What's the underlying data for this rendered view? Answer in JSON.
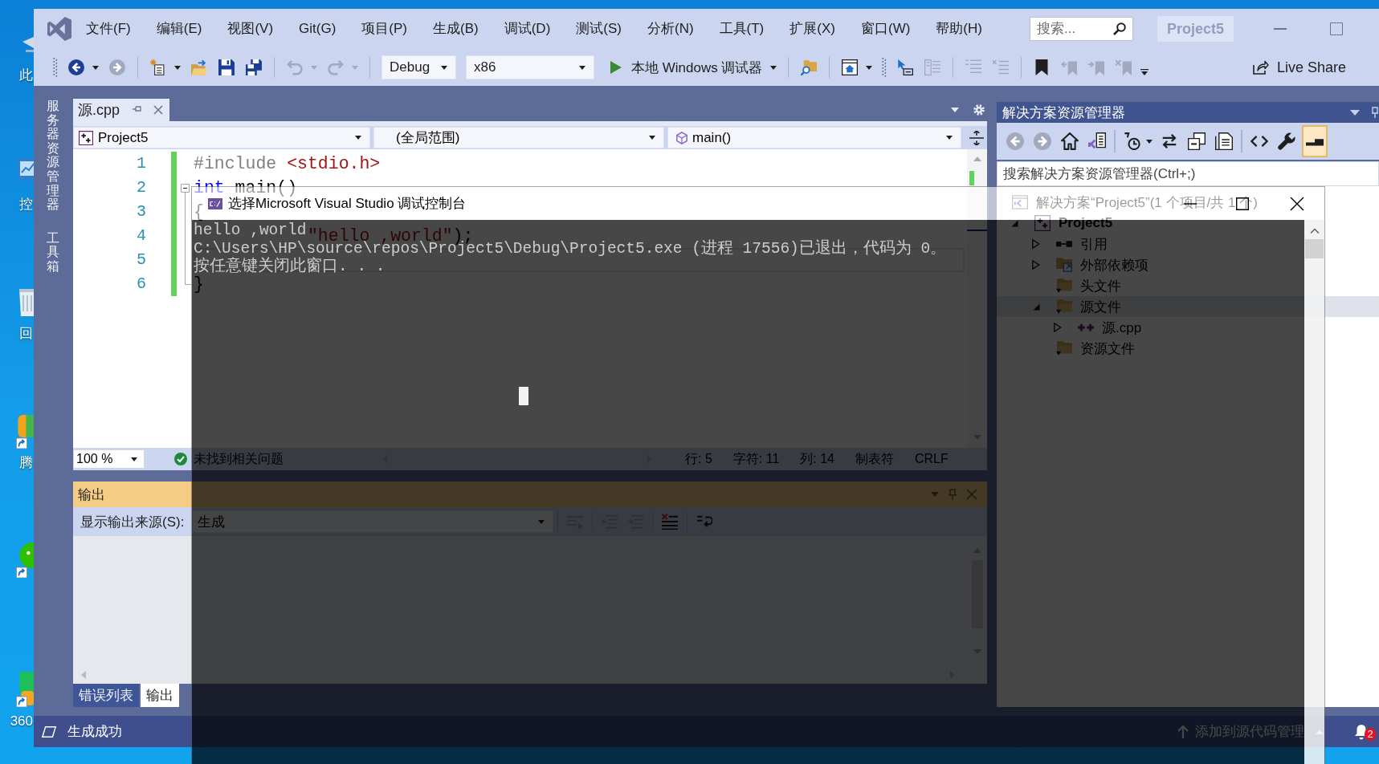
{
  "desktop": {
    "icons": [
      {
        "kind": "computer",
        "label": "此",
        "shortcut": false
      },
      {
        "kind": "control-panel",
        "label": "控",
        "shortcut": false
      },
      {
        "kind": "recycle-bin",
        "label": "回",
        "shortcut": false
      },
      {
        "kind": "app",
        "label": "腾",
        "shortcut": true
      },
      {
        "kind": "chat",
        "shortcut": true
      },
      {
        "kind": "shield",
        "label": "360",
        "shortcut": true
      }
    ]
  },
  "ide": {
    "menu": [
      "文件(F)",
      "编辑(E)",
      "视图(V)",
      "Git(G)",
      "项目(P)",
      "生成(B)",
      "调试(D)",
      "测试(S)",
      "分析(N)",
      "工具(T)",
      "扩展(X)",
      "窗口(W)",
      "帮助(H)"
    ],
    "search": {
      "placeholder": "搜索..."
    },
    "title": "Project5",
    "toolbar": {
      "items": [
        {
          "kind": "grip"
        },
        {
          "kind": "back",
          "disabled": false,
          "dropdown": true
        },
        {
          "kind": "forward",
          "disabled": true,
          "dropdown": false
        },
        {
          "kind": "separator"
        },
        {
          "kind": "new-project",
          "disabled": false,
          "dropdown": true
        },
        {
          "kind": "open",
          "disabled": false,
          "dropdown": false
        },
        {
          "kind": "save",
          "disabled": false,
          "dropdown": false
        },
        {
          "kind": "save-all",
          "disabled": false,
          "dropdown": false
        },
        {
          "kind": "separator"
        },
        {
          "kind": "undo",
          "disabled": true,
          "dropdown": true
        },
        {
          "kind": "redo",
          "disabled": true,
          "dropdown": true
        },
        {
          "kind": "separator"
        },
        {
          "kind": "combo",
          "value": "Debug"
        },
        {
          "kind": "combo",
          "value": "x86"
        },
        {
          "kind": "start",
          "label": "本地 Windows 调试器"
        },
        {
          "kind": "separator"
        },
        {
          "kind": "find-in-files",
          "disabled": false,
          "dropdown": false
        },
        {
          "kind": "separator"
        },
        {
          "kind": "browser",
          "disabled": false,
          "dropdown": true
        },
        {
          "kind": "grip"
        },
        {
          "kind": "step",
          "disabled": false,
          "dropdown": false
        },
        {
          "kind": "format",
          "disabled": true,
          "dropdown": false
        },
        {
          "kind": "separator"
        },
        {
          "kind": "comment",
          "disabled": true,
          "dropdown": false
        },
        {
          "kind": "uncomment",
          "disabled": true,
          "dropdown": false
        },
        {
          "kind": "separator"
        },
        {
          "kind": "bookmark",
          "disabled": false,
          "dropdown": false
        },
        {
          "kind": "bookmark-prev",
          "disabled": true,
          "dropdown": false
        },
        {
          "kind": "bookmark-next",
          "disabled": true,
          "dropdown": false
        },
        {
          "kind": "bookmark-clear",
          "disabled": true,
          "dropdown": false
        },
        {
          "kind": "overflow"
        }
      ],
      "live_share": "Live Share"
    },
    "side_tabs": [
      "服务器资源管理器",
      "工具箱"
    ],
    "editor": {
      "tabs": [
        {
          "label": "源.cpp",
          "selected": true
        }
      ],
      "navigation": {
        "project": "Project5",
        "scope": "(全局范围)",
        "member": "main()"
      },
      "lines": [
        {
          "number": "1",
          "changed": true,
          "kind": "line",
          "current": false,
          "tokens": [
            {
              "kind": "preprocessor",
              "text": "#include "
            },
            {
              "kind": "string",
              "text": "<stdio.h>"
            }
          ]
        },
        {
          "number": "2",
          "changed": true,
          "kind": "fold-start",
          "expanded": true,
          "current": false,
          "tokens": [
            {
              "kind": "keyword",
              "text": "int"
            },
            {
              "kind": "plain",
              "text": " main()"
            }
          ]
        },
        {
          "number": "3",
          "changed": true,
          "kind": "fold-body",
          "current": false,
          "tokens": [
            {
              "kind": "plain",
              "text": "{"
            }
          ]
        },
        {
          "number": "4",
          "changed": true,
          "kind": "fold-body",
          "current": false,
          "tokens": [
            {
              "kind": "string",
              "text": "           \"hello ,world\""
            },
            {
              "kind": "plain",
              "text": ");"
            }
          ]
        },
        {
          "number": "5",
          "changed": true,
          "kind": "fold-body",
          "current": true
        },
        {
          "number": "6",
          "changed": true,
          "kind": "fold-end",
          "current": false,
          "tokens": [
            {
              "kind": "plain",
              "text": "}"
            }
          ]
        }
      ],
      "zoom": "100 %",
      "issues": "未找到相关问题",
      "status": [
        "行: 5",
        "字符: 11",
        "列: 14",
        "制表符",
        "CRLF"
      ]
    },
    "output": {
      "title": "输出",
      "source_label": "显示输出来源(S):",
      "source": "生成",
      "tools": [
        {
          "kind": "separator"
        },
        {
          "kind": "find",
          "disabled": true
        },
        {
          "kind": "separator"
        },
        {
          "kind": "previous",
          "disabled": true
        },
        {
          "kind": "next",
          "disabled": true
        },
        {
          "kind": "separator"
        },
        {
          "kind": "clear",
          "disabled": false
        },
        {
          "kind": "separator"
        },
        {
          "kind": "word-wrap",
          "disabled": false
        }
      ],
      "tabs": [
        {
          "label": "错误列表",
          "selected": false
        },
        {
          "label": "输出",
          "selected": true
        }
      ]
    },
    "solution_explorer": {
      "title": "解决方案资源管理器",
      "tools": [
        {
          "kind": "back",
          "disabled": true,
          "dropdown": false,
          "on": false
        },
        {
          "kind": "forward",
          "disabled": true,
          "dropdown": false,
          "on": false
        },
        {
          "kind": "home",
          "disabled": false,
          "dropdown": false,
          "on": false
        },
        {
          "kind": "switch-views",
          "disabled": false,
          "dropdown": false,
          "on": false
        },
        {
          "kind": "separator"
        },
        {
          "kind": "pending-changes",
          "disabled": false,
          "dropdown": true,
          "on": false
        },
        {
          "kind": "sync",
          "disabled": false,
          "dropdown": false,
          "on": false
        },
        {
          "kind": "collapse",
          "disabled": false,
          "dropdown": false,
          "on": false
        },
        {
          "kind": "show-all",
          "disabled": false,
          "dropdown": false,
          "on": false
        },
        {
          "kind": "separator"
        },
        {
          "kind": "code",
          "disabled": false,
          "dropdown": false,
          "on": false
        },
        {
          "kind": "properties",
          "disabled": false,
          "dropdown": false,
          "on": false
        },
        {
          "kind": "preview",
          "disabled": false,
          "dropdown": false,
          "on": true
        }
      ],
      "search": {
        "placeholder": "搜索解决方案资源管理器(Ctrl+;)"
      },
      "tree": [
        {
          "kind": "solution",
          "label": "解决方案“Project5”(1 个项目/共 1 个)",
          "selected": false,
          "children": [
            {
              "kind": "project",
              "label": "Project5",
              "expanded": true,
              "selected": false,
              "children": [
                {
                  "kind": "references",
                  "label": "引用",
                  "expanded": false,
                  "selected": false
                },
                {
                  "kind": "external",
                  "label": "外部依赖项",
                  "expanded": false,
                  "selected": false
                },
                {
                  "kind": "folder",
                  "label": "头文件",
                  "selected": false
                },
                {
                  "kind": "folder",
                  "label": "源文件",
                  "expanded": true,
                  "selected": true,
                  "children": [
                    {
                      "kind": "cpp",
                      "label": "源.cpp",
                      "expanded": false,
                      "selected": false
                    }
                  ]
                },
                {
                  "kind": "folder",
                  "label": "资源文件",
                  "selected": false
                }
              ]
            }
          ]
        }
      ]
    },
    "status_bar": {
      "message": "生成成功",
      "source_control": "添加到源代码管理",
      "notifications": "2"
    }
  },
  "console": {
    "title": "选择Microsoft Visual Studio 调试控制台",
    "lines": [
      "hello ,world",
      "C:\\Users\\HP\\source\\repos\\Project5\\Debug\\Project5.exe (进程 17556)已退出，代码为 0。",
      "按任意键关闭此窗口. . ."
    ]
  }
}
